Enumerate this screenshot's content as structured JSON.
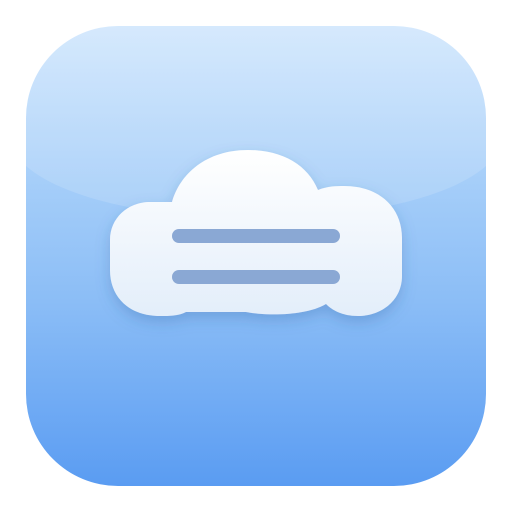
{
  "app_icon": {
    "glyph": "cloud-menu-icon",
    "colors": {
      "background_top": "#cfe6fd",
      "background_bottom": "#5a9cf2",
      "cloud_top": "#ffffff",
      "cloud_bottom": "#e3eefa",
      "line": "#8aa8d4"
    }
  }
}
